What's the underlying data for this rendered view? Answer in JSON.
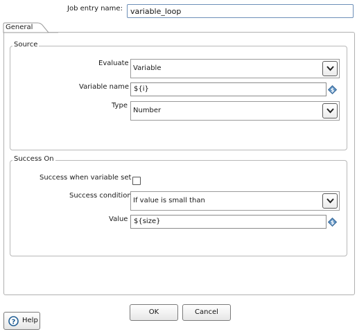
{
  "job_entry": {
    "label": "Job entry name:",
    "value": "variable_loop"
  },
  "tabs": [
    {
      "label": "General"
    }
  ],
  "source": {
    "title": "Source",
    "evaluate": {
      "label": "Evaluate",
      "value": "Variable"
    },
    "variable_name": {
      "label": "Variable name",
      "value": "${i}"
    },
    "type": {
      "label": "Type",
      "value": "Number"
    }
  },
  "success_on": {
    "title": "Success On",
    "when_variable_set": {
      "label": "Success when variable set",
      "checked": false
    },
    "condition": {
      "label": "Success condition",
      "value": "If value is small than"
    },
    "value": {
      "label": "Value",
      "value": "${size}"
    }
  },
  "buttons": {
    "ok": "OK",
    "cancel": "Cancel",
    "help": "Help"
  },
  "icons": {
    "variable_insert": "diamond-dollar-icon",
    "dropdown": "chevron-down-icon",
    "help": "help-icon"
  },
  "colors": {
    "variable_icon": "#5b8fc0",
    "field_focus_border": "#6d8fb8"
  }
}
